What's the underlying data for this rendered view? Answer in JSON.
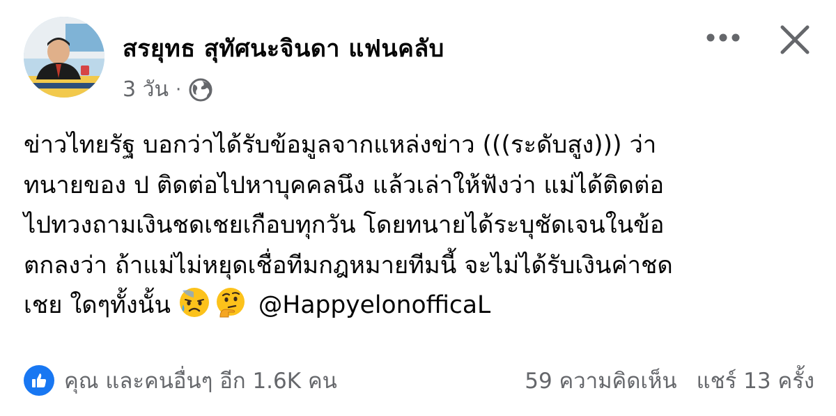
{
  "post": {
    "author": "สรยุทธ สุทัศนะจินดา แฟนคลับ",
    "time": "3 วัน",
    "separator": "·",
    "privacy_icon": "globe-icon",
    "body_lines": [
      "ข่าวไทยรัฐ บอกว่าได้รับข้อมูลจากแหล่งข่าว (((ระดับสูง))) ว่า",
      "ทนายของ ป ติดต่อไปหาบุคคลนึง แล้วเล่าให้ฟังว่า แม่ได้ติดต่อ",
      "ไปทวงถามเงินชดเชยเกือบทุกวัน โดยทนายได้ระบุชัดเจนในข้อ",
      "ตกลงว่า ถ้าแม่ไม่หยุดเชื่อทีมกฎหมายทีมนี้ จะไม่ได้รับเงินค่าชด",
      "เชย ใดๆทั้งนั้น"
    ],
    "emojis": [
      "sad-sweat-face-emoji",
      "thinking-face-emoji"
    ],
    "mention": "@HappyelonofficaL"
  },
  "footer": {
    "reaction_icon": "like-icon",
    "reactions_text": "คุณ และคนอื่นๆ อีก 1.6K คน",
    "comments_text": "59 ความคิดเห็น",
    "shares_text": "แชร์ 13 ครั้ง"
  },
  "colors": {
    "primary_text": "#050505",
    "secondary_text": "#65676b",
    "like_blue": "#1877f2"
  }
}
